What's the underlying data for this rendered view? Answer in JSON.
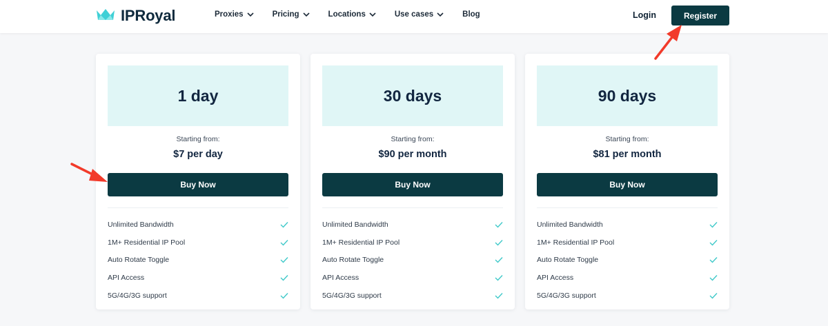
{
  "header": {
    "logo_text": "IPRoyal",
    "nav": [
      {
        "label": "Proxies",
        "has_dropdown": true
      },
      {
        "label": "Pricing",
        "has_dropdown": true
      },
      {
        "label": "Locations",
        "has_dropdown": true
      },
      {
        "label": "Use cases",
        "has_dropdown": true
      },
      {
        "label": "Blog",
        "has_dropdown": false
      }
    ],
    "login_label": "Login",
    "register_label": "Register"
  },
  "colors": {
    "primary": "#0b3a42",
    "plan_box_bg": "#e0f6f6",
    "check": "#3fc9c9",
    "logo_icon": "#3fd0d6",
    "annotation_arrow": "#f23a2a"
  },
  "plans": [
    {
      "title": "1 day",
      "starting_label": "Starting from:",
      "price": "$7 per day",
      "button_label": "Buy Now",
      "features": [
        "Unlimited Bandwidth",
        "1M+ Residential IP Pool",
        "Auto Rotate Toggle",
        "API Access",
        "5G/4G/3G support"
      ]
    },
    {
      "title": "30 days",
      "starting_label": "Starting from:",
      "price": "$90 per month",
      "button_label": "Buy Now",
      "features": [
        "Unlimited Bandwidth",
        "1M+ Residential IP Pool",
        "Auto Rotate Toggle",
        "API Access",
        "5G/4G/3G support"
      ]
    },
    {
      "title": "90 days",
      "starting_label": "Starting from:",
      "price": "$81 per month",
      "button_label": "Buy Now",
      "features": [
        "Unlimited Bandwidth",
        "1M+ Residential IP Pool",
        "Auto Rotate Toggle",
        "API Access",
        "5G/4G/3G support"
      ]
    }
  ],
  "icons": {
    "feature_check": "check-icon",
    "nav_dropdown": "chevron-down-icon",
    "logo": "crown-icon",
    "annotation": "red-arrow-icon"
  }
}
